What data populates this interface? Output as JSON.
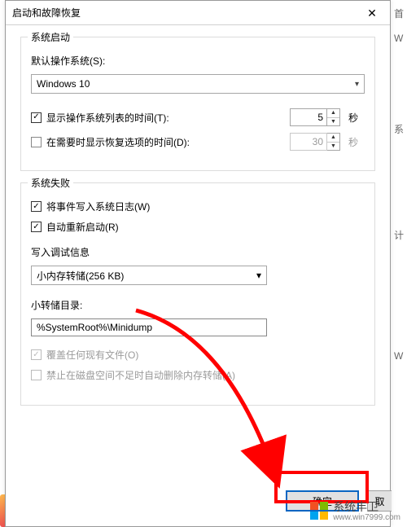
{
  "dialog": {
    "title": "启动和故障恢复",
    "close_glyph": "✕"
  },
  "startup": {
    "legend": "系统启动",
    "default_os_label": "默认操作系统(S):",
    "default_os_value": "Windows 10",
    "show_list_label": "显示操作系统列表的时间(T):",
    "show_list_checked": true,
    "show_list_value": "5",
    "show_recovery_label": "在需要时显示恢复选项的时间(D):",
    "show_recovery_checked": false,
    "show_recovery_value": "30",
    "seconds_unit": "秒"
  },
  "failure": {
    "legend": "系统失败",
    "log_label": "将事件写入系统日志(W)",
    "log_checked": true,
    "restart_label": "自动重新启动(R)",
    "restart_checked": true,
    "debug_info_label": "写入调试信息",
    "debug_select_value": "小内存转储(256 KB)",
    "dump_dir_label": "小转储目录:",
    "dump_dir_value": "%SystemRoot%\\Minidump",
    "overwrite_label": "覆盖任何现有文件(O)",
    "overwrite_checked": true,
    "nodelete_label": "禁止在磁盘空间不足时自动删除内存转储(A)",
    "nodelete_checked": false
  },
  "buttons": {
    "ok": "确定",
    "cancel": "取"
  },
  "right_edge": {
    "c1": "首",
    "c2": "W",
    "c3": "系",
    "c4": "计",
    "c5": "W"
  },
  "watermark": {
    "brand": "系统丰卫",
    "url": "www.win7999.com"
  }
}
